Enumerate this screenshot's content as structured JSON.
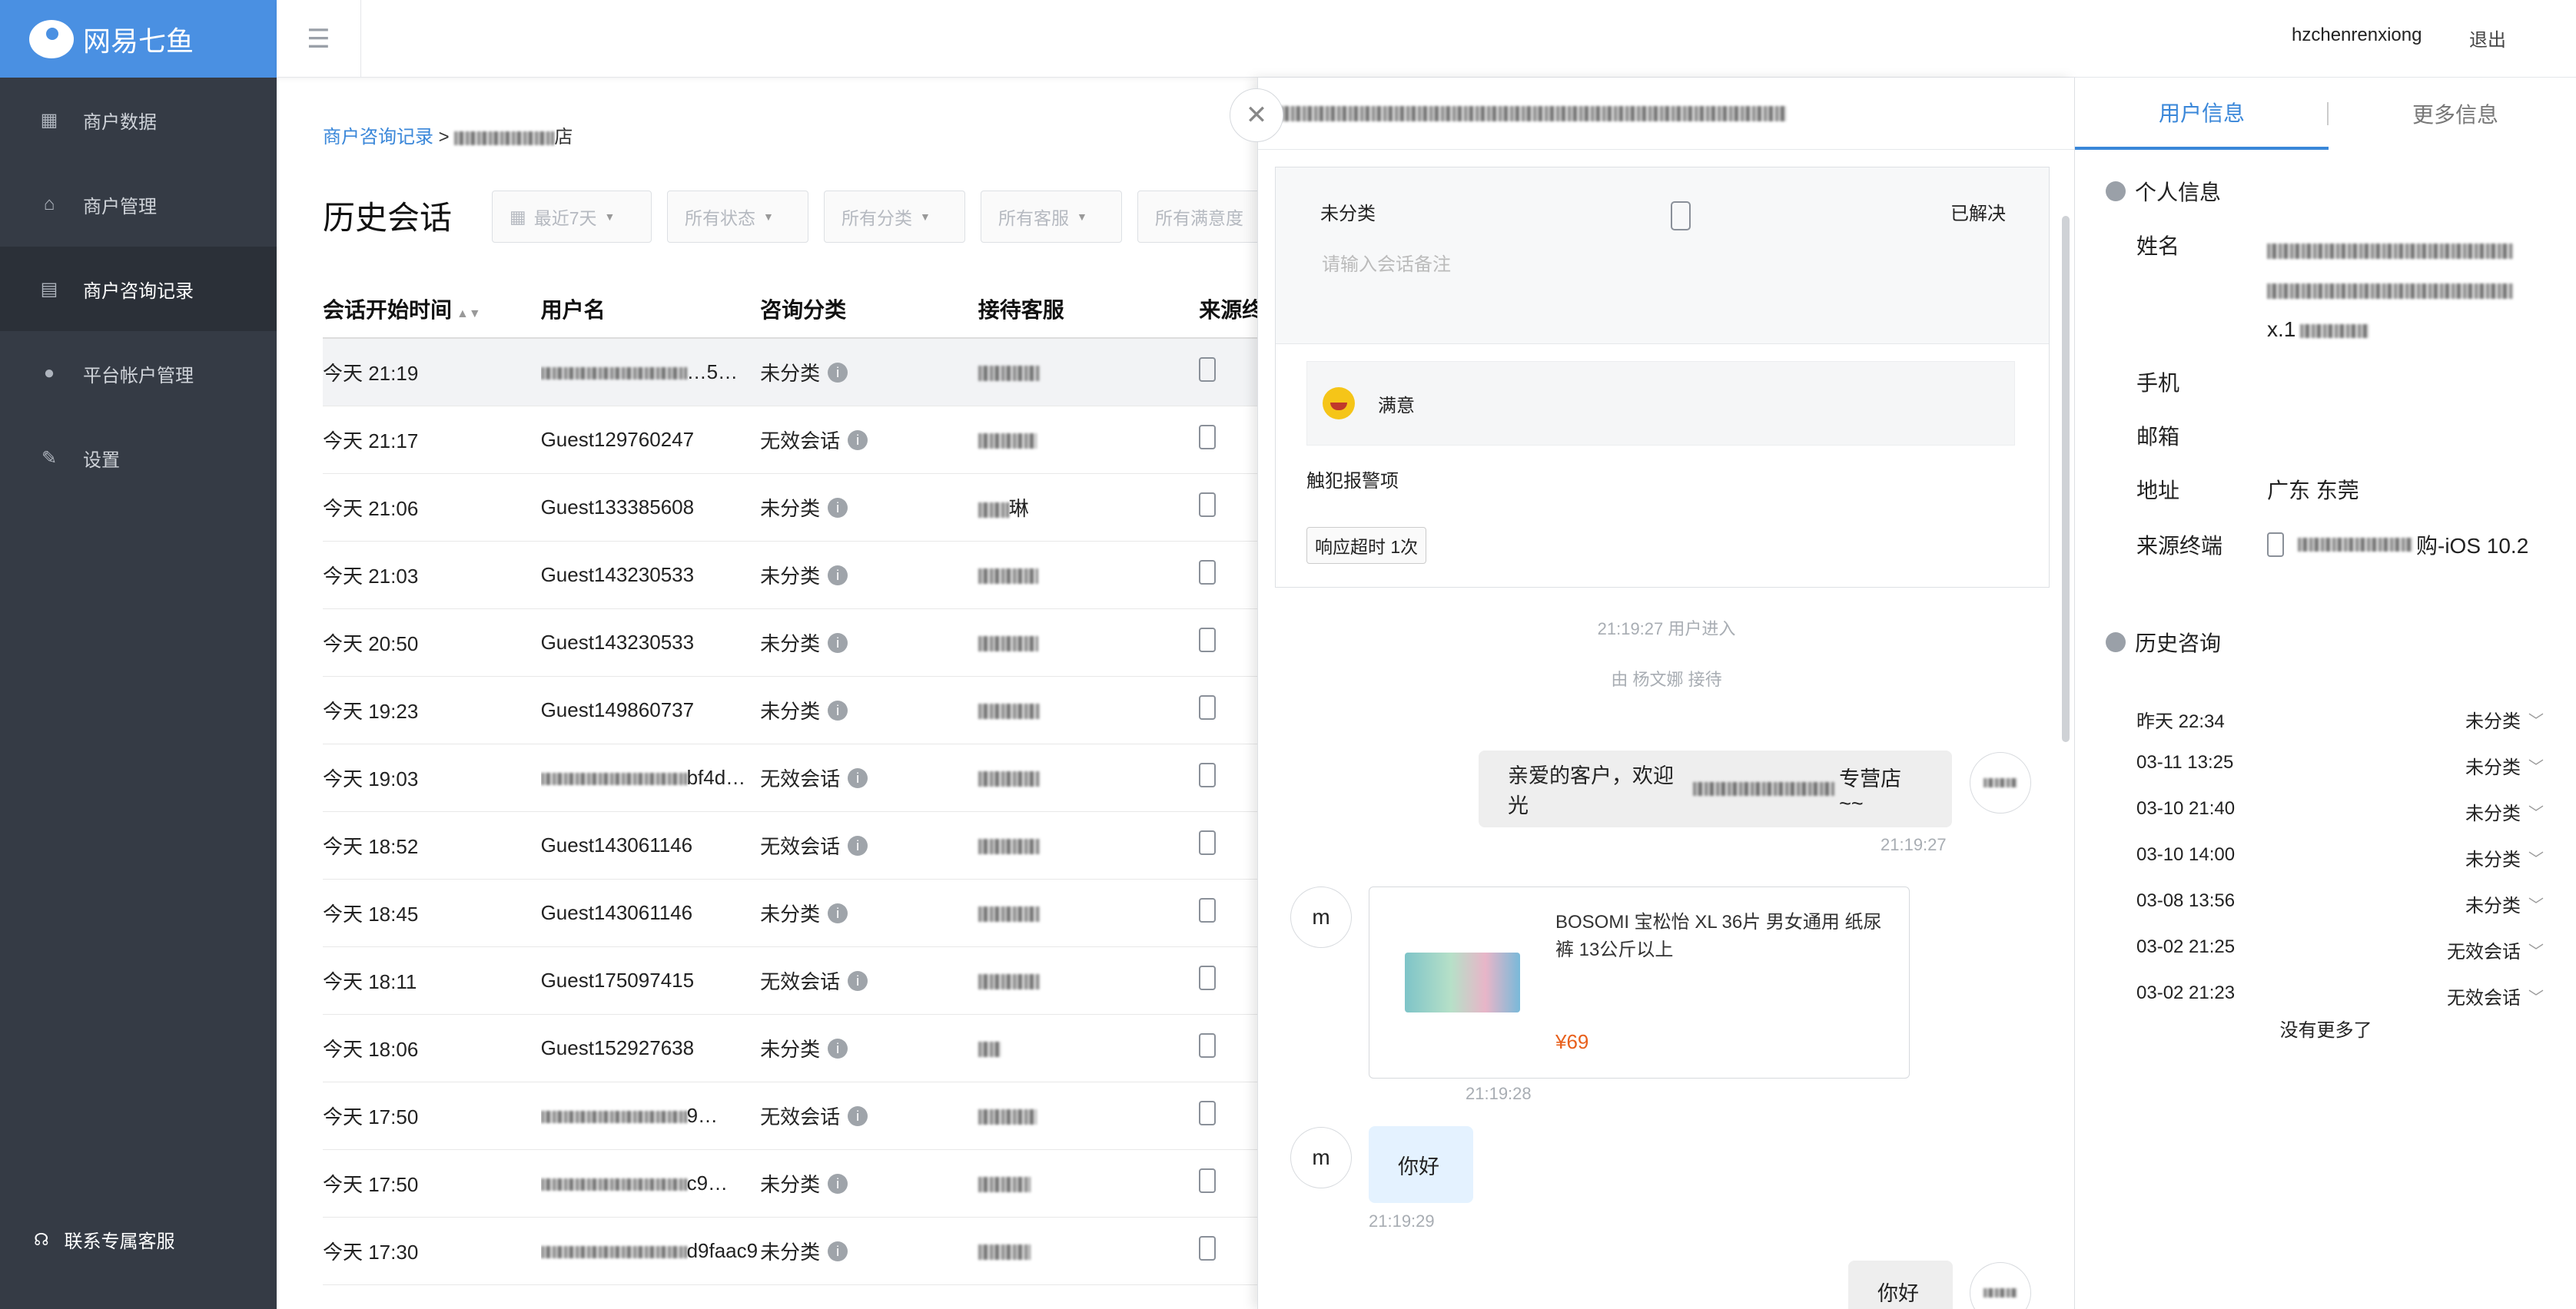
{
  "app": {
    "brand": "网易七鱼"
  },
  "sidebar": {
    "items": [
      {
        "label": "商户数据"
      },
      {
        "label": "商户管理"
      },
      {
        "label": "商户咨询记录"
      },
      {
        "label": "平台帐户管理"
      },
      {
        "label": "设置"
      }
    ],
    "support_label": "联系专属客服"
  },
  "header": {
    "username": "hzchenrenxiong",
    "logout_label": "退出"
  },
  "breadcrumb": {
    "root": "商户咨询记录",
    "separator": ">",
    "current_suffix": "店"
  },
  "page": {
    "title": "历史会话"
  },
  "filters": {
    "date": "最近7天",
    "status": "所有状态",
    "category": "所有分类",
    "agent": "所有客服",
    "satisfaction": "所有满意度"
  },
  "table": {
    "columns": [
      "会话开始时间",
      "用户名",
      "咨询分类",
      "接待客服",
      "来源终"
    ],
    "rows": [
      {
        "time": "今天 21:19",
        "user": "…5…",
        "category": "未分类",
        "agent": ""
      },
      {
        "time": "今天 21:17",
        "user": "Guest129760247",
        "category": "无效会话",
        "agent": ""
      },
      {
        "time": "今天 21:06",
        "user": "Guest133385608",
        "category": "未分类",
        "agent": "琳"
      },
      {
        "time": "今天 21:03",
        "user": "Guest143230533",
        "category": "未分类",
        "agent": ""
      },
      {
        "time": "今天 20:50",
        "user": "Guest143230533",
        "category": "未分类",
        "agent": ""
      },
      {
        "time": "今天 19:23",
        "user": "Guest149860737",
        "category": "未分类",
        "agent": ""
      },
      {
        "time": "今天 19:03",
        "user": "bf4d…",
        "category": "无效会话",
        "agent": ""
      },
      {
        "time": "今天 18:52",
        "user": "Guest143061146",
        "category": "无效会话",
        "agent": ""
      },
      {
        "time": "今天 18:45",
        "user": "Guest143061146",
        "category": "未分类",
        "agent": ""
      },
      {
        "time": "今天 18:11",
        "user": "Guest175097415",
        "category": "无效会话",
        "agent": ""
      },
      {
        "time": "今天 18:06",
        "user": "Guest152927638",
        "category": "未分类",
        "agent": ""
      },
      {
        "time": "今天 17:50",
        "user": "9…",
        "category": "无效会话",
        "agent": ""
      },
      {
        "time": "今天 17:50",
        "user": "c9…",
        "category": "未分类",
        "agent": ""
      },
      {
        "time": "今天 17:30",
        "user": "d9faac9…",
        "category": "未分类",
        "agent": ""
      }
    ]
  },
  "session": {
    "category": "未分类",
    "status": "已解决",
    "remark_placeholder": "请输入会话备注",
    "satisfaction": "满意",
    "alarm_label": "触犯报警项",
    "timeout_tag": "响应超时 1次"
  },
  "chat": {
    "events": {
      "enter": "21:19:27 用户进入",
      "receiver": "由 杨文娜 接待"
    },
    "msg1": {
      "prefix": "亲爱的客户，欢迎光",
      "suffix": "专营店~~",
      "time": "21:19:27"
    },
    "product": {
      "name": "BOSOMI 宝松怡 XL 36片 男女通用 纸尿裤 13公斤以上",
      "price": "¥69",
      "time": "21:19:28"
    },
    "user_avatar": "m",
    "msg2": {
      "text": "你好",
      "time": "21:19:29"
    },
    "msg3": {
      "text": "你好"
    }
  },
  "info_panel": {
    "tabs": [
      "用户信息",
      "更多信息"
    ],
    "personal_title": "个人信息",
    "fields": {
      "name_label": "姓名",
      "name_value_tail": "x.1",
      "phone_label": "手机",
      "email_label": "邮箱",
      "address_label": "地址",
      "address_value": "广东 东莞",
      "source_label": "来源终端",
      "source_value_suffix": "购-iOS 10.2"
    },
    "history_title": "历史咨询",
    "history": [
      {
        "time": "昨天 22:34",
        "status": "未分类"
      },
      {
        "time": "03-11 13:25",
        "status": "未分类"
      },
      {
        "time": "03-10 21:40",
        "status": "未分类"
      },
      {
        "time": "03-10 14:00",
        "status": "未分类"
      },
      {
        "time": "03-08 13:56",
        "status": "未分类"
      },
      {
        "time": "03-02 21:25",
        "status": "无效会话"
      },
      {
        "time": "03-02 21:23",
        "status": "无效会话"
      }
    ],
    "no_more": "没有更多了"
  },
  "colors": {
    "sidebar_bg": "#353b45",
    "brand_blue": "#4a90e2",
    "link_blue": "#3a87d9",
    "price": "#e8601c"
  }
}
